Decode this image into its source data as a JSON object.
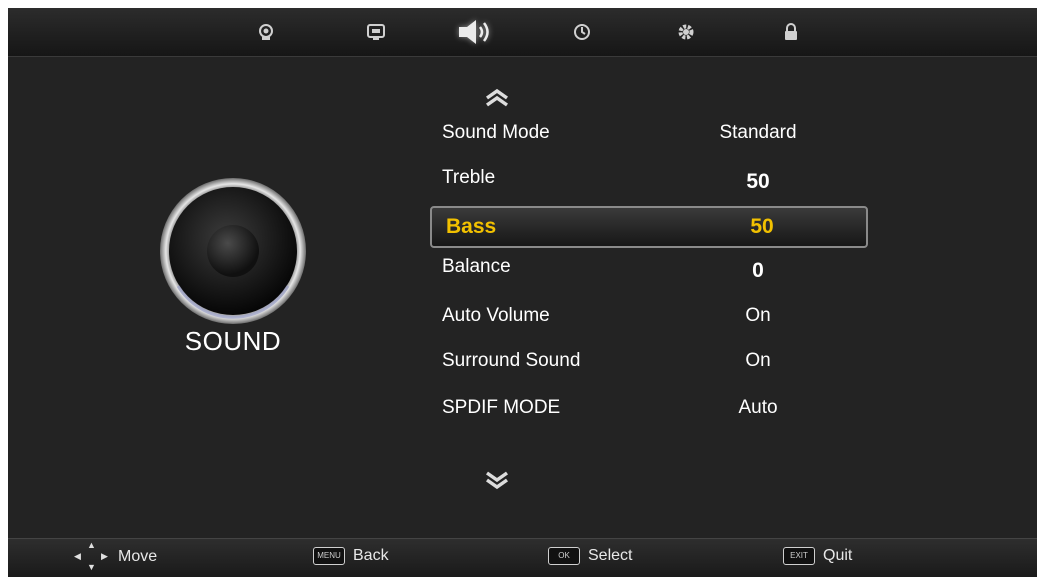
{
  "top_tabs": [
    {
      "icon": "picture-icon",
      "active": false
    },
    {
      "icon": "channel-icon",
      "active": false
    },
    {
      "icon": "speaker-volume-icon",
      "active": true
    },
    {
      "icon": "clock-icon",
      "active": false
    },
    {
      "icon": "gear-icon",
      "active": false
    },
    {
      "icon": "lock-icon",
      "active": false
    }
  ],
  "section": {
    "title": "SOUND",
    "icon": "speaker-cone-icon"
  },
  "menu": {
    "scroll_up_icon": "double-chevron-up-icon",
    "scroll_down_icon": "double-chevron-down-icon",
    "items": [
      {
        "label": "Sound Mode",
        "value": "Standard"
      },
      {
        "label": "Treble",
        "value": "50"
      },
      {
        "label": "Bass",
        "value": "50",
        "selected": true
      },
      {
        "label": "Balance",
        "value": "0"
      },
      {
        "label": "Auto Volume",
        "value": "On"
      },
      {
        "label": "Surround Sound",
        "value": "On"
      },
      {
        "label": "SPDIF MODE",
        "value": "Auto"
      }
    ]
  },
  "footer": {
    "move": "Move",
    "back_key": "MENU",
    "back": "Back",
    "select_key": "OK",
    "select": "Select",
    "quit_key": "EXIT",
    "quit": "Quit"
  },
  "colors": {
    "highlight": "#f2c100",
    "background": "#232323"
  }
}
